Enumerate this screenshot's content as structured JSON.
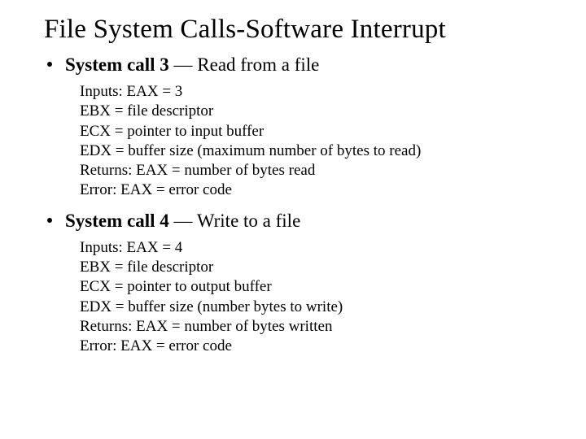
{
  "title": "File System Calls-Software Interrupt",
  "items": [
    {
      "headingBold": "System call 3",
      "headingRest": " — Read from a file",
      "lines": [
        "Inputs: EAX = 3",
        "EBX = file descriptor",
        "ECX = pointer to input buffer",
        "EDX = buffer size (maximum number of bytes to read)",
        "Returns: EAX = number of bytes read",
        "Error: EAX = error code"
      ]
    },
    {
      "headingBold": "System call 4",
      "headingRest": " — Write to a file",
      "lines": [
        "Inputs: EAX = 4",
        "EBX = file descriptor",
        "ECX = pointer to output buffer",
        "EDX = buffer size (number bytes to write)",
        "Returns: EAX = number of bytes written",
        "Error: EAX = error code"
      ]
    }
  ]
}
